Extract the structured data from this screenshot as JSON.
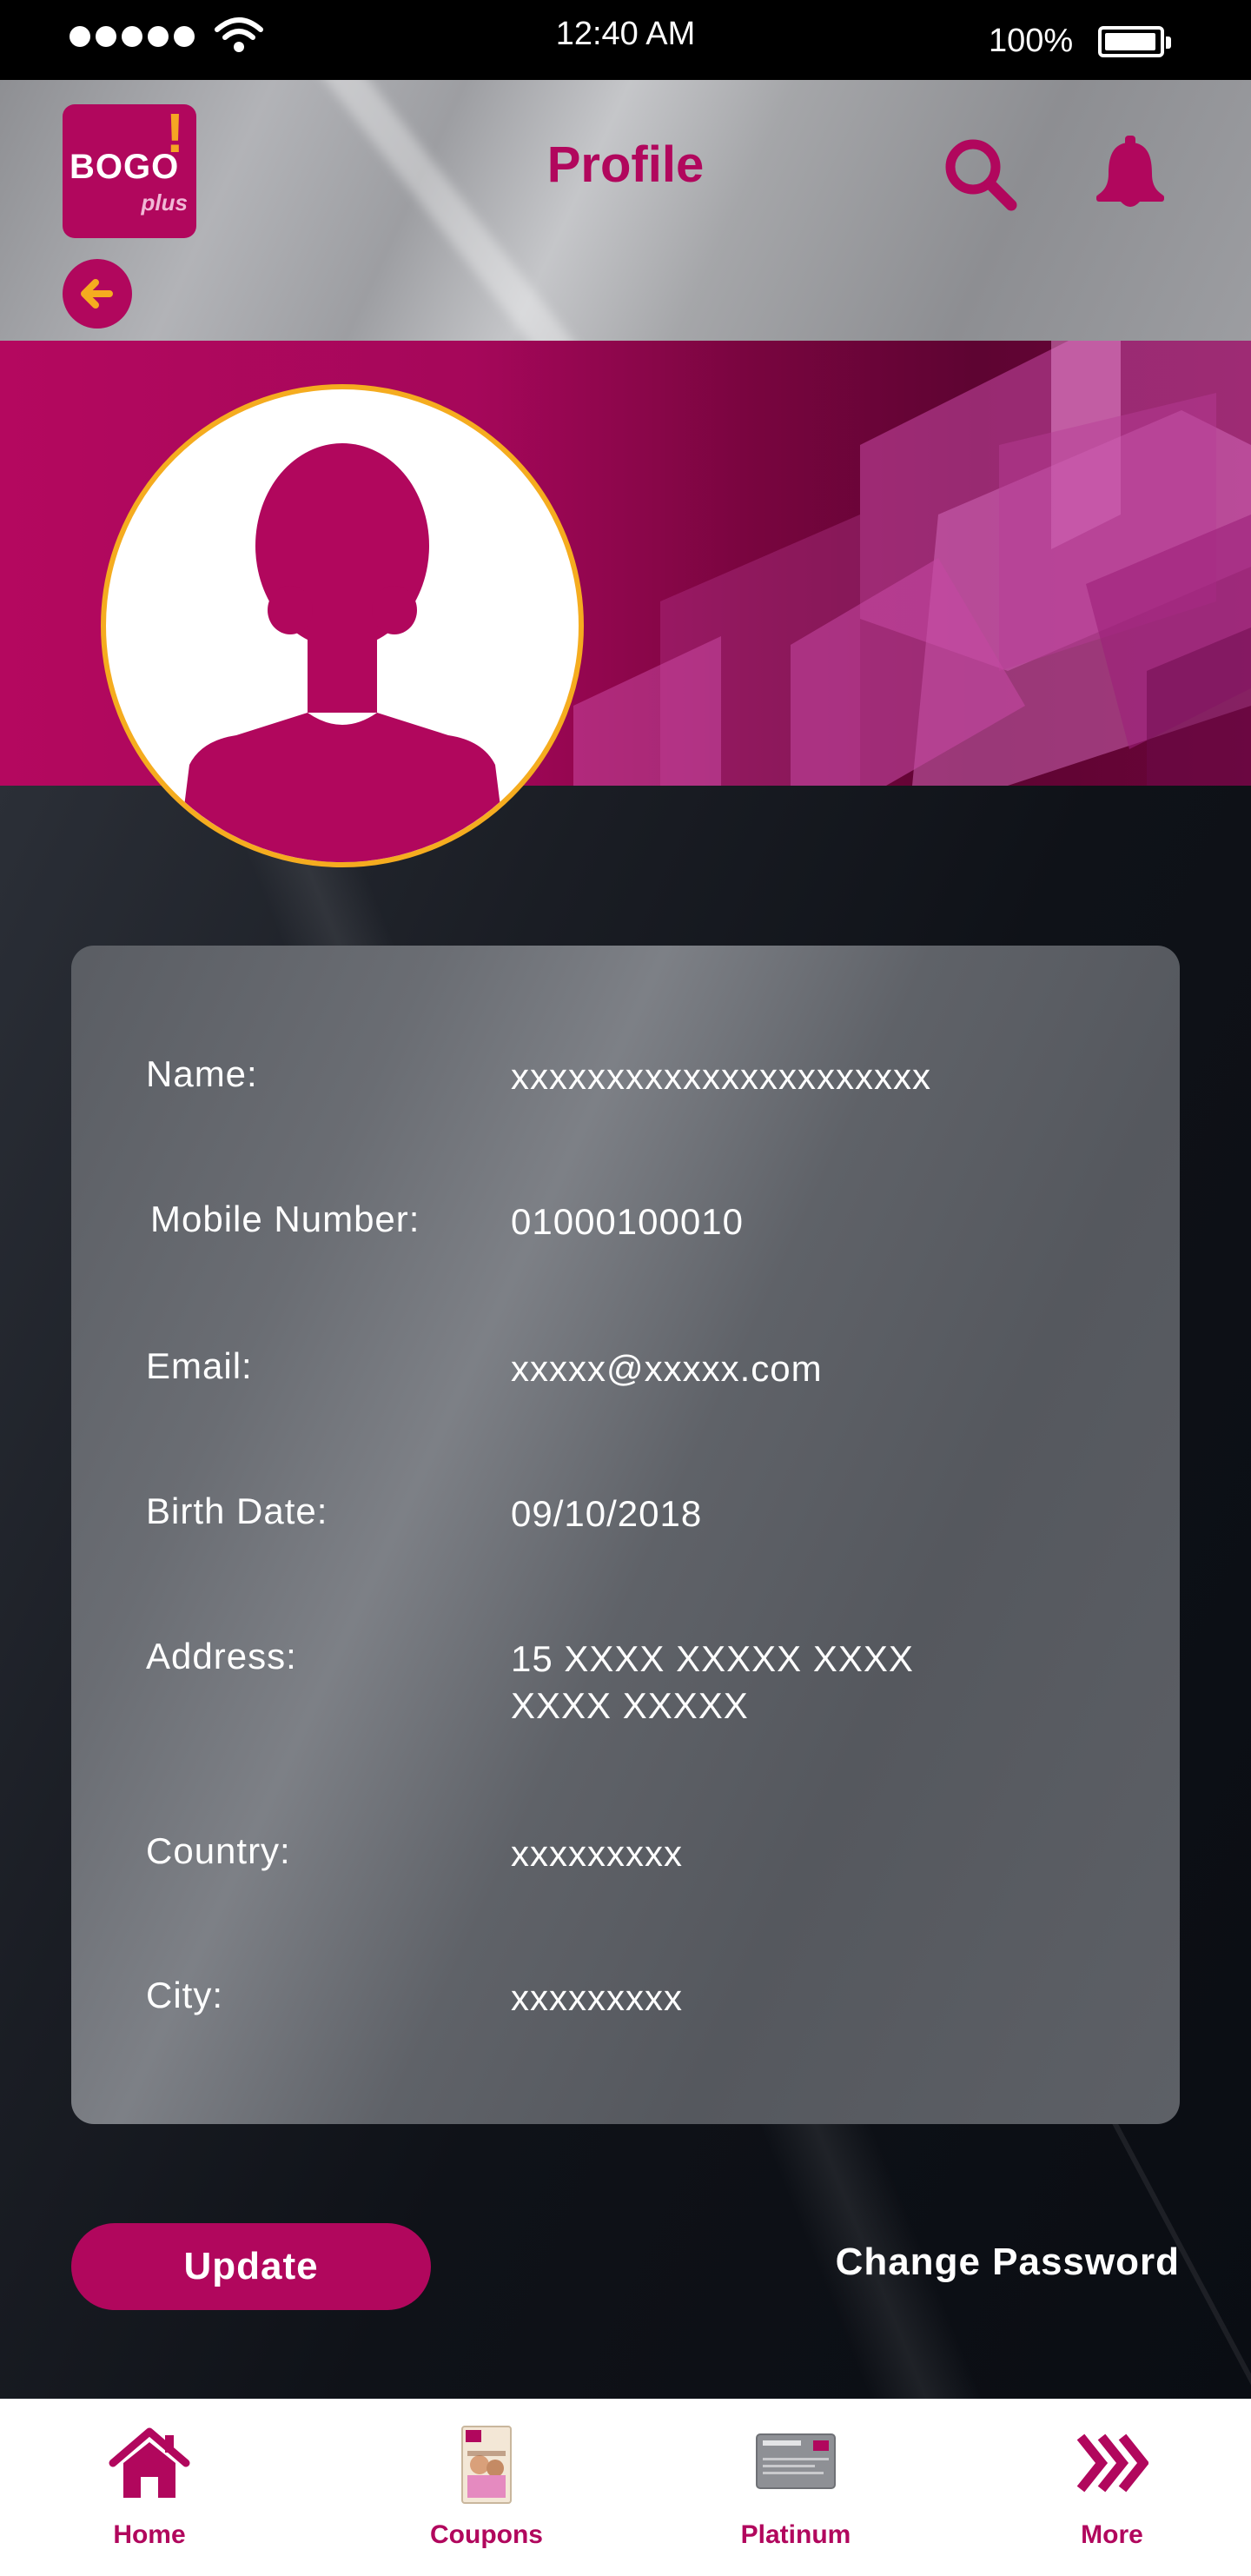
{
  "status_bar": {
    "time": "12:40 AM",
    "battery": "100%"
  },
  "header": {
    "title": "Profile",
    "logo_main": "BOGO",
    "logo_sub": "plus",
    "logo_mark": "!"
  },
  "profile": {
    "fields": [
      {
        "label": "Name:",
        "value": "xxxxxxxxxxxxxxxxxxxxxx"
      },
      {
        "label": "Mobile Number:",
        "value": "01000100010"
      },
      {
        "label": "Email:",
        "value": "xxxxx@xxxxx.com"
      },
      {
        "label": "Birth Date:",
        "value": "09/10/2018"
      },
      {
        "label": "Address:",
        "value": "15 XXXX XXXXX XXXX XXXX XXXXX"
      },
      {
        "label": "Country:",
        "value": "xxxxxxxxx"
      },
      {
        "label": "City:",
        "value": "xxxxxxxxx"
      }
    ]
  },
  "actions": {
    "update_label": "Update",
    "change_password_label": "Change Password"
  },
  "bottom_nav": {
    "items": [
      {
        "label": "Home",
        "icon": "home-icon"
      },
      {
        "label": "Coupons",
        "icon": "coupons-book-icon"
      },
      {
        "label": "Platinum",
        "icon": "platinum-card-icon"
      },
      {
        "label": "More",
        "icon": "chevrons-right-icon"
      }
    ]
  },
  "colors": {
    "brand": "#b1075d",
    "accent": "#f5ac1f"
  }
}
